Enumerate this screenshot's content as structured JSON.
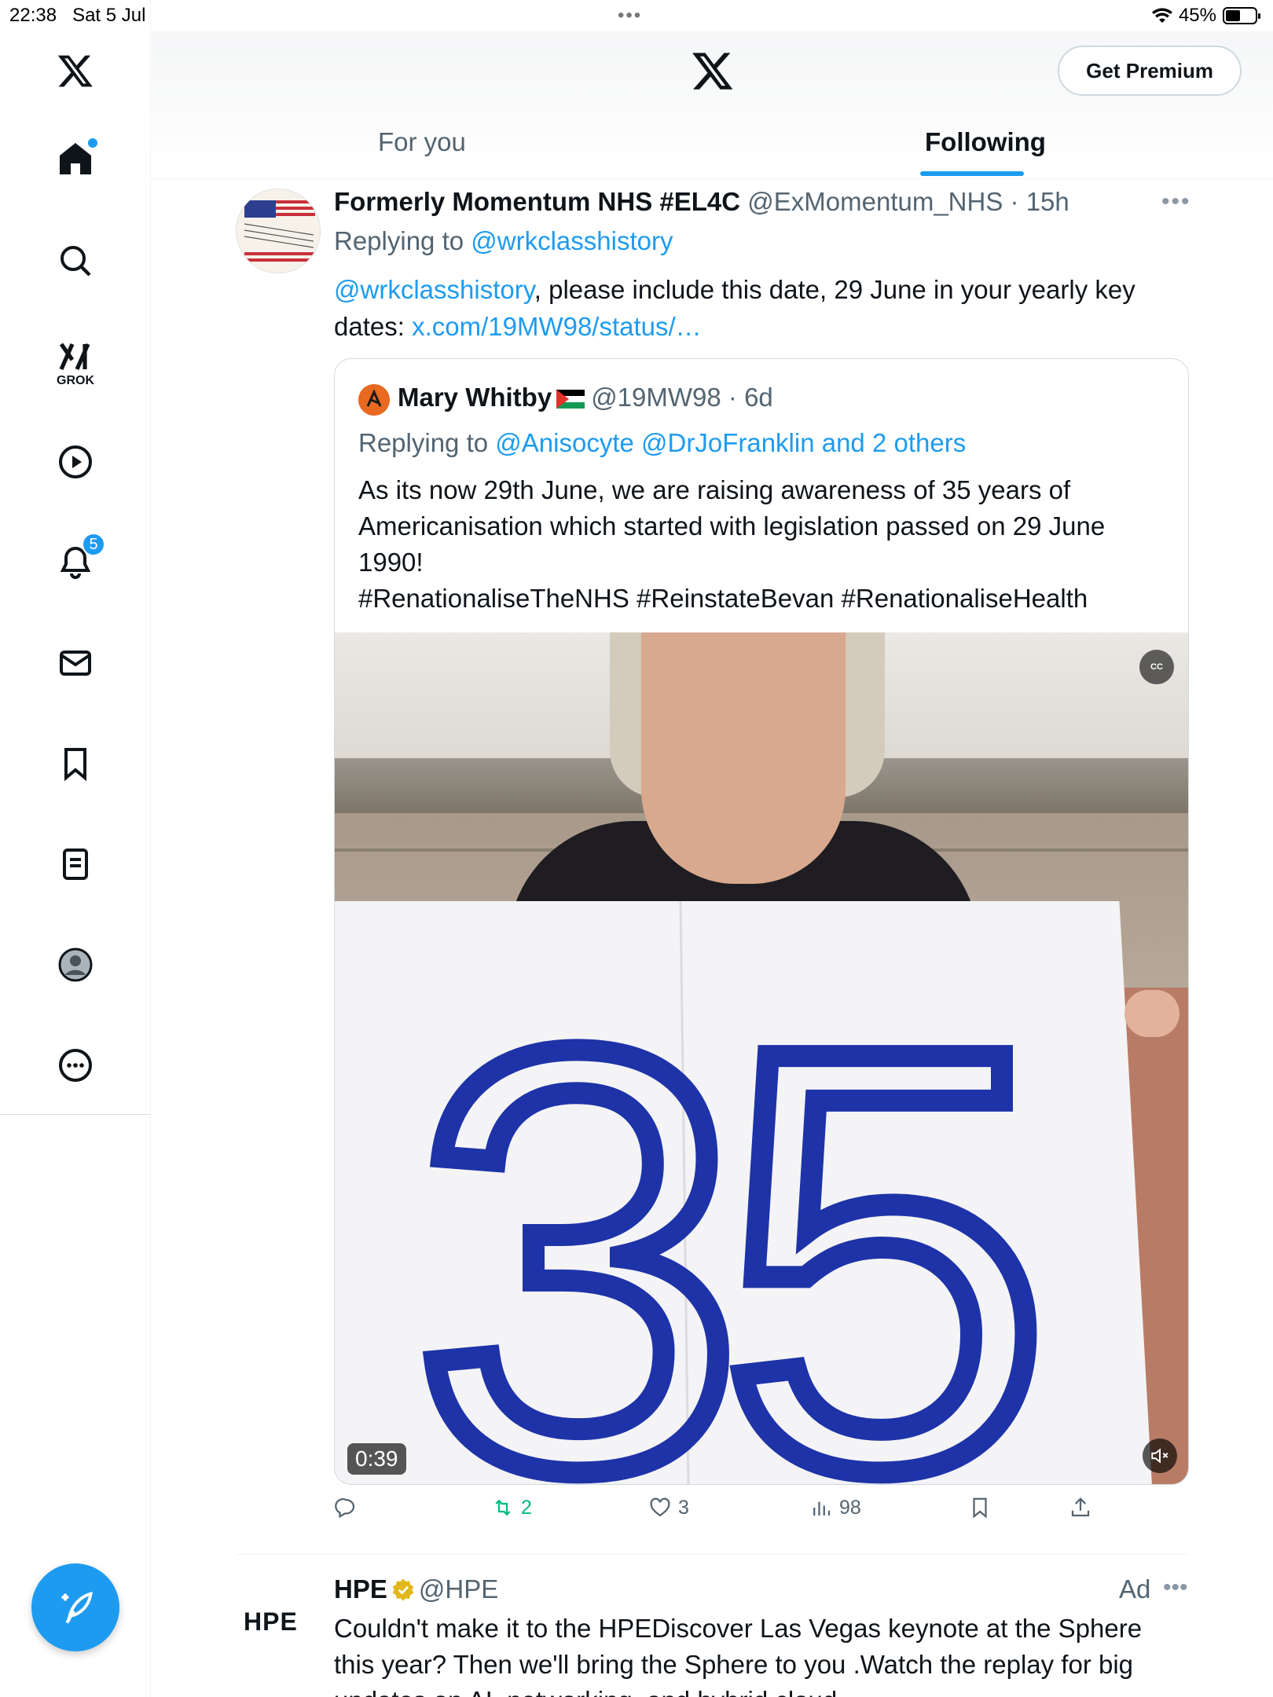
{
  "status_bar": {
    "time": "22:38",
    "date": "Sat 5 Jul",
    "dots": "•••",
    "battery": "45%"
  },
  "header": {
    "premium_label": "Get Premium",
    "tabs": [
      {
        "label": "For you"
      },
      {
        "label": "Following"
      }
    ]
  },
  "sidebar": {
    "grok_label": "GROK",
    "notifications_count": "5",
    "icons": [
      "x-logo-icon",
      "home-icon",
      "search-icon",
      "grok-icon",
      "video-icon",
      "bell-icon",
      "mail-icon",
      "bookmark-icon",
      "lists-icon",
      "profile-icon",
      "more-icon",
      "compose-icon"
    ]
  },
  "tweet": {
    "name": "Formerly Momentum NHS #EL4C",
    "handle": "@ExMomentum_NHS",
    "time": "15h",
    "replying_prefix": "Replying to",
    "replying_to": "@wrkclasshistory",
    "mention": "@wrkclasshistory",
    "text": ", please include this date, 29 June in your yearly key dates: ",
    "link": "x.com/19MW98/status/…",
    "quote": {
      "name": "Mary Whitby",
      "handle": "@19MW98",
      "time": "6d",
      "replying_prefix": "Replying to",
      "replying_to": "@Anisocyte @DrJoFranklin and 2 others",
      "text_line1": "As its  now 29th June, we are raising awareness of 35 years of Americanisation which started with legislation passed on 29 June 1990!",
      "text_line2": "#RenationaliseTheNHS #ReinstateBevan #RenationaliseHealth",
      "video": {
        "sign_text": "35",
        "duration": "0:39",
        "cc_label": "CC"
      }
    },
    "actions": {
      "retweets": "2",
      "likes": "3",
      "views": "98"
    }
  },
  "ad": {
    "logo": "HPE",
    "name": "HPE",
    "handle": "@HPE",
    "label": "Ad",
    "text": "Couldn't make it to the HPEDiscover Las Vegas keynote at the Sphere this year? Then we'll bring the Sphere to you .Watch the replay for big updates on AI, networking, and hybrid cloud."
  },
  "colors": {
    "accent": "#1d9bf0",
    "retweet": "#00ba7c",
    "ink": "#0f1419",
    "muted": "#536471"
  }
}
